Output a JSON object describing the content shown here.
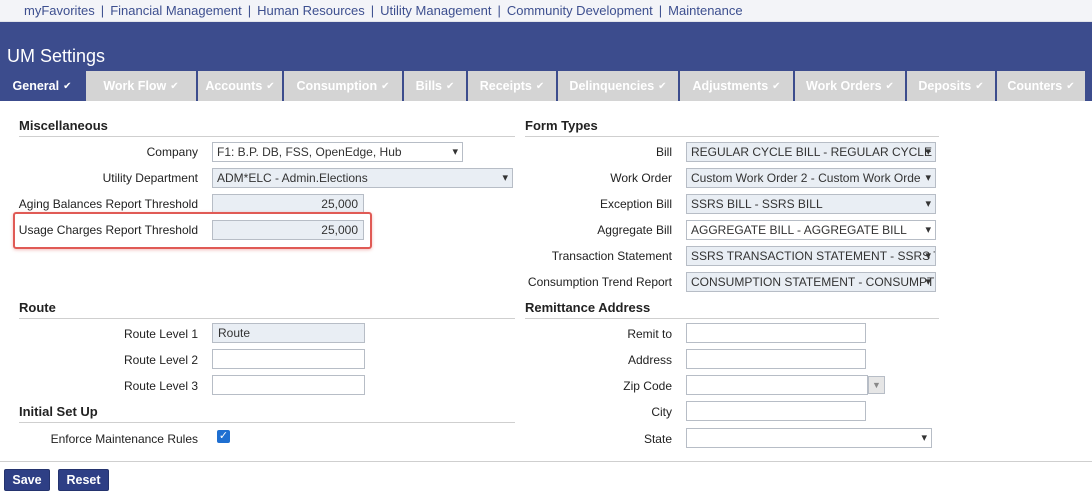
{
  "topnav": {
    "items": [
      "myFavorites",
      "Financial Management",
      "Human Resources",
      "Utility Management",
      "Community Development",
      "Maintenance"
    ]
  },
  "header": {
    "title": "UM Settings"
  },
  "tabs": [
    {
      "label": "General"
    },
    {
      "label": "Work Flow"
    },
    {
      "label": "Accounts"
    },
    {
      "label": "Consumption"
    },
    {
      "label": "Bills"
    },
    {
      "label": "Receipts"
    },
    {
      "label": "Delinquencies"
    },
    {
      "label": "Adjustments"
    },
    {
      "label": "Work Orders"
    },
    {
      "label": "Deposits"
    },
    {
      "label": "Counters"
    }
  ],
  "colors": {
    "brand": "#3c4c8d",
    "tab_inactive": "#d4d4d4",
    "highlight": "#e05a55",
    "checkbox": "#1f6fd1"
  },
  "misc": {
    "title": "Miscellaneous",
    "company_label": "Company",
    "company_value": "F1: B.P. DB, FSS, OpenEdge, Hub",
    "utility_label": "Utility Department",
    "utility_value": "ADM*ELC - Admin.Elections",
    "aging_label": "Aging Balances Report Threshold",
    "aging_value": "25,000",
    "usage_label": "Usage Charges Report Threshold",
    "usage_value": "25,000"
  },
  "route": {
    "title": "Route",
    "level1_label": "Route Level 1",
    "level1_value": "Route",
    "level2_label": "Route Level 2",
    "level2_value": "",
    "level3_label": "Route Level 3",
    "level3_value": ""
  },
  "setup": {
    "title": "Initial Set Up",
    "enforce_label": "Enforce Maintenance Rules",
    "enforce_checked": true
  },
  "forms": {
    "title": "Form Types",
    "bill_label": "Bill",
    "bill_value": "REGULAR CYCLE BILL - REGULAR CYCLE BIL",
    "workorder_label": "Work Order",
    "workorder_value": "Custom Work Order 2 - Custom Work Orde",
    "exception_label": "Exception Bill",
    "exception_value": "SSRS BILL - SSRS BILL",
    "aggregate_label": "Aggregate Bill",
    "aggregate_value": "AGGREGATE BILL - AGGREGATE BILL",
    "transaction_label": "Transaction Statement",
    "transaction_value": "SSRS TRANSACTION STATEMENT - SSRS TR",
    "trend_label": "Consumption Trend Report",
    "trend_value": "CONSUMPTION STATEMENT - CONSUMPT"
  },
  "remit": {
    "title": "Remittance Address",
    "remit_label": "Remit to",
    "address_label": "Address",
    "zip_label": "Zip Code",
    "city_label": "City",
    "state_label": "State"
  },
  "buttons": {
    "save": "Save",
    "reset": "Reset"
  }
}
